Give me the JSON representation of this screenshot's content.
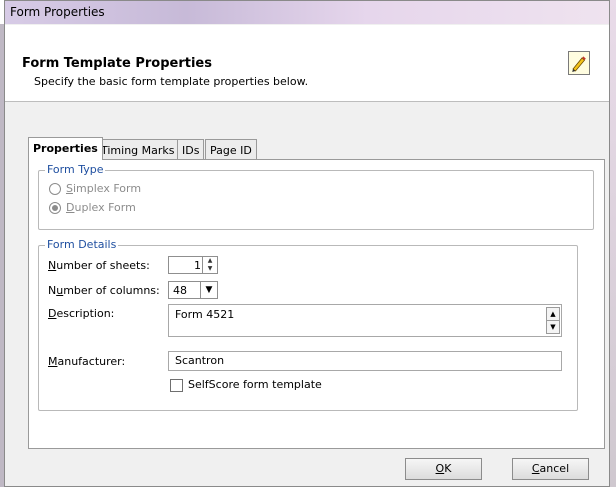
{
  "window": {
    "title": "Form Properties"
  },
  "header": {
    "title": "Form Template Properties",
    "subtitle": "Specify the basic form template properties below.",
    "icon": "edit-pencil-icon"
  },
  "tabs": [
    {
      "label": "Properties",
      "active": true
    },
    {
      "label": "Timing Marks",
      "active": false
    },
    {
      "label": "IDs",
      "active": false
    },
    {
      "label": "Page ID",
      "active": false
    }
  ],
  "form_type": {
    "legend": "Form Type",
    "options": [
      {
        "accel": "S",
        "rest": "implex Form",
        "checked": false
      },
      {
        "accel": "D",
        "rest": "uplex Form",
        "checked": true
      }
    ]
  },
  "form_details": {
    "legend": "Form Details",
    "sheets": {
      "pre": "",
      "accel": "N",
      "post": "umber of sheets:",
      "value": "1"
    },
    "columns": {
      "pre": "N",
      "accel": "u",
      "post": "mber of columns:",
      "value": "48"
    },
    "description": {
      "pre": "",
      "accel": "D",
      "post": "escription:",
      "value": "Form 4521"
    },
    "manufacturer": {
      "pre": "",
      "accel": "M",
      "post": "anufacturer:",
      "value": "Scantron"
    },
    "selfscore": {
      "label": "SelfScore form template",
      "checked": false
    }
  },
  "buttons": {
    "ok": {
      "accel": "O",
      "rest": "K"
    },
    "cancel": {
      "accel": "C",
      "rest": "ancel"
    }
  }
}
